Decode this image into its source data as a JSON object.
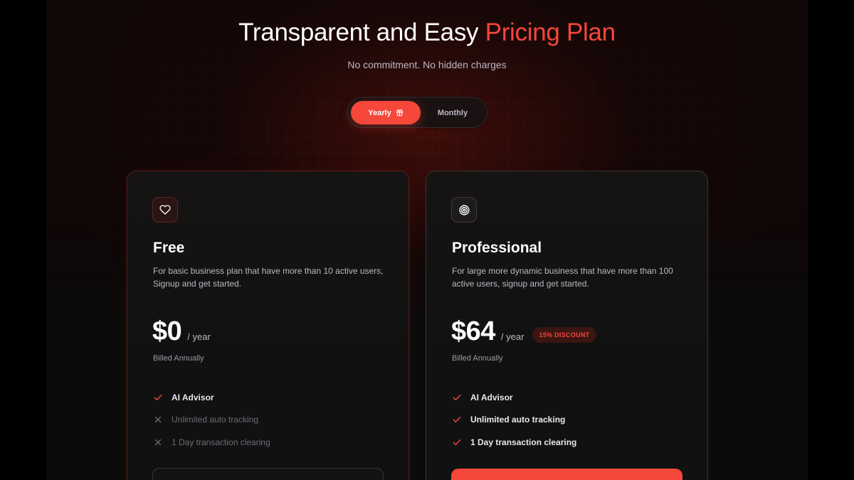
{
  "header": {
    "title_main": "Transparent and Easy ",
    "title_accent": "Pricing Plan",
    "subtitle": "No commitment. No hidden charges"
  },
  "billing_toggle": {
    "yearly_label": "Yearly",
    "yearly_icon": "gift-icon",
    "monthly_label": "Monthly",
    "selected": "Yearly"
  },
  "plans": [
    {
      "icon": "heart-icon",
      "name": "Free",
      "description": "For basic business plan that have more than 10 active users, Signup and get started.",
      "price": "$0",
      "period": "/ year",
      "billed": "Billed Annually",
      "features": [
        {
          "label": "AI Advisor",
          "included": true
        },
        {
          "label": "Unlimited auto tracking",
          "included": false
        },
        {
          "label": "1 Day transaction clearing",
          "included": false
        }
      ]
    },
    {
      "icon": "target-icon",
      "name": "Professional",
      "description": "For large more dynamic business that have more than 100 active users, signup and get started.",
      "price": "$64",
      "period": "/ year",
      "discount": "15% DISCOUNT",
      "billed": "Billed Annually",
      "features": [
        {
          "label": "AI Advisor",
          "included": true
        },
        {
          "label": "Unlimited auto tracking",
          "included": true
        },
        {
          "label": "1 Day transaction clearing",
          "included": true
        }
      ]
    }
  ],
  "colors": {
    "accent": "#f5473a",
    "muted_text": "#b9b9c4",
    "background": "#0b0b0b"
  }
}
